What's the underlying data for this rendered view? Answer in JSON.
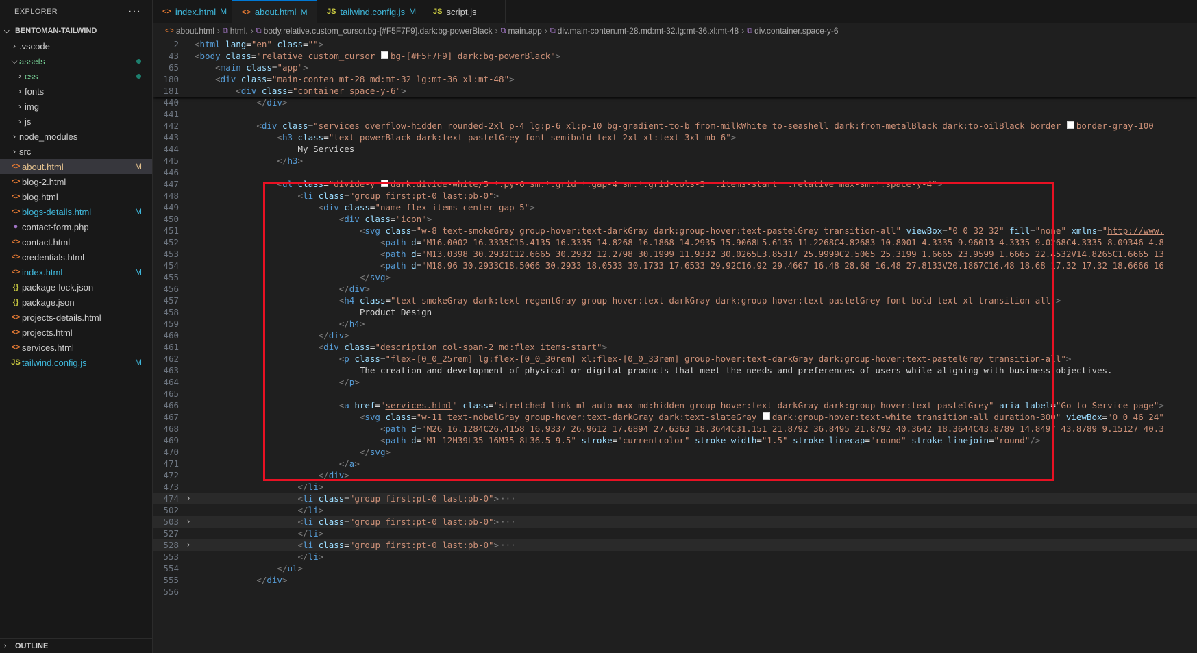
{
  "explorer": {
    "title": "EXPLORER",
    "more": "···",
    "project": "BENTOMAN-TAILWIND",
    "items": [
      {
        "label": ".vscode",
        "type": "folder",
        "indent": 1,
        "open": false,
        "color": "#cccccc"
      },
      {
        "label": "assets",
        "type": "folder",
        "indent": 1,
        "open": true,
        "color": "#73c991",
        "dot": true
      },
      {
        "label": "css",
        "type": "folder",
        "indent": 2,
        "open": false,
        "color": "#73c991",
        "dot": true
      },
      {
        "label": "fonts",
        "type": "folder",
        "indent": 2,
        "open": false,
        "color": "#cccccc"
      },
      {
        "label": "img",
        "type": "folder",
        "indent": 2,
        "open": false,
        "color": "#cccccc"
      },
      {
        "label": "js",
        "type": "folder",
        "indent": 2,
        "open": false,
        "color": "#cccccc"
      },
      {
        "label": "node_modules",
        "type": "folder",
        "indent": 1,
        "open": false,
        "color": "#cccccc"
      },
      {
        "label": "src",
        "type": "folder",
        "indent": 1,
        "open": false,
        "color": "#cccccc"
      },
      {
        "label": "about.html",
        "type": "html",
        "indent": 1,
        "color": "#e2c08d",
        "badge": "M",
        "active": true
      },
      {
        "label": "blog-2.html",
        "type": "html",
        "indent": 1,
        "color": "#cccccc"
      },
      {
        "label": "blog.html",
        "type": "html",
        "indent": 1,
        "color": "#cccccc"
      },
      {
        "label": "blogs-details.html",
        "type": "html",
        "indent": 1,
        "color": "#3fb6d9",
        "badge": "M"
      },
      {
        "label": "contact-form.php",
        "type": "php",
        "indent": 1,
        "color": "#cccccc"
      },
      {
        "label": "contact.html",
        "type": "html",
        "indent": 1,
        "color": "#cccccc"
      },
      {
        "label": "credentials.html",
        "type": "html",
        "indent": 1,
        "color": "#cccccc"
      },
      {
        "label": "index.html",
        "type": "html",
        "indent": 1,
        "color": "#3fb6d9",
        "badge": "M"
      },
      {
        "label": "package-lock.json",
        "type": "json",
        "indent": 1,
        "color": "#cccccc"
      },
      {
        "label": "package.json",
        "type": "json",
        "indent": 1,
        "color": "#cccccc"
      },
      {
        "label": "projects-details.html",
        "type": "html",
        "indent": 1,
        "color": "#cccccc"
      },
      {
        "label": "projects.html",
        "type": "html",
        "indent": 1,
        "color": "#cccccc"
      },
      {
        "label": "services.html",
        "type": "html",
        "indent": 1,
        "color": "#cccccc"
      },
      {
        "label": "tailwind.config.js",
        "type": "js",
        "indent": 1,
        "color": "#3fb6d9",
        "badge": "M"
      }
    ],
    "outline": "OUTLINE"
  },
  "tabs": [
    {
      "label": "index.html",
      "icon": "<>",
      "iconColor": "#e37933",
      "mod": "M",
      "color": "#3fb6d9",
      "active": false
    },
    {
      "label": "about.html",
      "icon": "<>",
      "iconColor": "#e37933",
      "mod": "M",
      "color": "#3fb6d9",
      "active": true
    },
    {
      "label": "tailwind.config.js",
      "icon": "JS",
      "iconColor": "#cbcb41",
      "mod": "M",
      "color": "#3fb6d9",
      "active": false
    },
    {
      "label": "script.js",
      "icon": "JS",
      "iconColor": "#cbcb41",
      "mod": "",
      "color": "#cccccc",
      "active": false
    }
  ],
  "breadcrumb": [
    {
      "label": "about.html",
      "icon": "<>"
    },
    {
      "label": "html.",
      "icon": "⧉"
    },
    {
      "label": "body.relative.custom_cursor.bg-[#F5F7F9].dark:bg-powerBlack",
      "icon": "⧉"
    },
    {
      "label": "main.app",
      "icon": "⧉"
    },
    {
      "label": "div.main-conten.mt-28.md:mt-32.lg:mt-36.xl:mt-48",
      "icon": "⧉"
    },
    {
      "label": "div.container.space-y-6",
      "icon": "⧉"
    }
  ],
  "code": {
    "sticky": [
      {
        "n": "2",
        "html": "<span class='p'>&lt;</span><span class='t'>html</span> <span class='a'>lang</span><span class='x'>=</span><span class='s'>\"en\"</span> <span class='a'>class</span><span class='x'>=</span><span class='s'>\"\"</span><span class='p'>&gt;</span>"
      },
      {
        "n": "43",
        "html": "<span class='p'>&lt;</span><span class='t'>body</span> <span class='a'>class</span><span class='x'>=</span><span class='s'>\"relative custom_cursor <span class='colorbox'></span>bg-[#F5F7F9] dark:bg-powerBlack\"</span><span class='p'>&gt;</span>"
      },
      {
        "n": "65",
        "html": "    <span class='p'>&lt;</span><span class='t'>main</span> <span class='a'>class</span><span class='x'>=</span><span class='s'>\"app\"</span><span class='p'>&gt;</span>"
      },
      {
        "n": "180",
        "html": "    <span class='p'>&lt;</span><span class='t'>div</span> <span class='a'>class</span><span class='x'>=</span><span class='s'>\"main-conten mt-28 md:mt-32 lg:mt-36 xl:mt-48\"</span><span class='p'>&gt;</span>"
      },
      {
        "n": "181",
        "html": "        <span class='p'>&lt;</span><span class='t'>div</span> <span class='a'>class</span><span class='x'>=</span><span class='s'>\"container space-y-6\"</span><span class='p'>&gt;</span>"
      }
    ],
    "lines": [
      {
        "n": "440",
        "html": "            <span class='p'>&lt;/</span><span class='t'>div</span><span class='p'>&gt;</span>"
      },
      {
        "n": "441",
        "html": ""
      },
      {
        "n": "442",
        "html": "            <span class='p'>&lt;</span><span class='t'>div</span> <span class='a'>class</span><span class='x'>=</span><span class='s'>\"services overflow-hidden rounded-2xl p-4 lg:p-6 xl:p-10 bg-gradient-to-b from-milkWhite to-seashell dark:from-metalBlack dark:to-oilBlack border <span class='colorbox'></span>border-gray-100</span>"
      },
      {
        "n": "443",
        "html": "                <span class='p'>&lt;</span><span class='t'>h3</span> <span class='a'>class</span><span class='x'>=</span><span class='s'>\"text-powerBlack dark:text-pastelGrey font-semibold text-2xl xl:text-3xl mb-6\"</span><span class='p'>&gt;</span>"
      },
      {
        "n": "444",
        "html": "                    <span class='x'>My Services</span>"
      },
      {
        "n": "445",
        "html": "                <span class='p'>&lt;/</span><span class='t'>h3</span><span class='p'>&gt;</span>"
      },
      {
        "n": "446",
        "html": ""
      },
      {
        "n": "447",
        "html": "                <span class='p'>&lt;</span><span class='t'>ul</span> <span class='a'>class</span><span class='x'>=</span><span class='s'>\"divide-y <span class='colorbox dk'></span>dark:divide-white/5 *:py-6 sm:*:grid *:gap-4 sm:*:grid-cols-3 *:items-start *:relative max-sm:*:space-y-4\"</span><span class='p'>&gt;</span>"
      },
      {
        "n": "448",
        "html": "                    <span class='p'>&lt;</span><span class='t'>li</span> <span class='a'>class</span><span class='x'>=</span><span class='s'>\"group first:pt-0 last:pb-0\"</span><span class='p'>&gt;</span>"
      },
      {
        "n": "449",
        "html": "                        <span class='p'>&lt;</span><span class='t'>div</span> <span class='a'>class</span><span class='x'>=</span><span class='s'>\"name flex items-center gap-5\"</span><span class='p'>&gt;</span>"
      },
      {
        "n": "450",
        "html": "                            <span class='p'>&lt;</span><span class='t'>div</span> <span class='a'>class</span><span class='x'>=</span><span class='s'>\"icon\"</span><span class='p'>&gt;</span>"
      },
      {
        "n": "451",
        "html": "                                <span class='p'>&lt;</span><span class='t'>svg</span> <span class='a'>class</span><span class='x'>=</span><span class='s'>\"w-8 text-smokeGray group-hover:text-darkGray dark:group-hover:text-pastelGrey transition-all\"</span> <span class='a'>viewBox</span><span class='x'>=</span><span class='s'>\"0 0 32 32\"</span> <span class='a'>fill</span><span class='x'>=</span><span class='s'>\"none\"</span> <span class='a'>xmlns</span><span class='x'>=</span><span class='s'>\"<span class='u'>http://www.</span></span>"
      },
      {
        "n": "452",
        "html": "                                    <span class='p'>&lt;</span><span class='t'>path</span> <span class='a'>d</span><span class='x'>=</span><span class='s'>\"M16.0002 16.3335C15.4135 16.3335 14.8268 16.1868 14.2935 15.9068L5.6135 11.2268C4.82683 10.8001 4.3335 9.96013 4.3335 9.0268C4.3335 8.09346 4.8</span>"
      },
      {
        "n": "453",
        "html": "                                    <span class='p'>&lt;</span><span class='t'>path</span> <span class='a'>d</span><span class='x'>=</span><span class='s'>\"M13.0398 30.2932C12.6665 30.2932 12.2798 30.1999 11.9332 30.0265L3.85317 25.9999C2.5065 25.3199 1.6665 23.9599 1.6665 22.4532V14.8265C1.6665 13</span>"
      },
      {
        "n": "454",
        "html": "                                    <span class='p'>&lt;</span><span class='t'>path</span> <span class='a'>d</span><span class='x'>=</span><span class='s'>\"M18.96 30.2933C18.5066 30.2933 18.0533 30.1733 17.6533 29.92C16.92 29.4667 16.48 28.68 16.48 27.8133V20.1867C16.48 18.68 17.32 17.32 18.6666 16</span>"
      },
      {
        "n": "455",
        "html": "                                <span class='p'>&lt;/</span><span class='t'>svg</span><span class='p'>&gt;</span>"
      },
      {
        "n": "456",
        "html": "                            <span class='p'>&lt;/</span><span class='t'>div</span><span class='p'>&gt;</span>"
      },
      {
        "n": "457",
        "html": "                            <span class='p'>&lt;</span><span class='t'>h4</span> <span class='a'>class</span><span class='x'>=</span><span class='s'>\"text-smokeGray dark:text-regentGray group-hover:text-darkGray dark:group-hover:text-pastelGrey font-bold text-xl transition-all\"</span><span class='p'>&gt;</span>"
      },
      {
        "n": "458",
        "html": "                                <span class='x'>Product Design</span>"
      },
      {
        "n": "459",
        "html": "                            <span class='p'>&lt;/</span><span class='t'>h4</span><span class='p'>&gt;</span>"
      },
      {
        "n": "460",
        "html": "                        <span class='p'>&lt;/</span><span class='t'>div</span><span class='p'>&gt;</span>"
      },
      {
        "n": "461",
        "html": "                        <span class='p'>&lt;</span><span class='t'>div</span> <span class='a'>class</span><span class='x'>=</span><span class='s'>\"description col-span-2 md:flex items-start\"</span><span class='p'>&gt;</span>"
      },
      {
        "n": "462",
        "html": "                            <span class='p'>&lt;</span><span class='t'>p</span> <span class='a'>class</span><span class='x'>=</span><span class='s'>\"flex-[0_0_25rem] lg:flex-[0_0_30rem] xl:flex-[0_0_33rem] group-hover:text-darkGray dark:group-hover:text-pastelGrey transition-all\"</span><span class='p'>&gt;</span>"
      },
      {
        "n": "463",
        "html": "                                <span class='x'>The creation and development of physical or digital products that meet the needs and preferences of users while aligning with business objectives.</span>"
      },
      {
        "n": "464",
        "html": "                            <span class='p'>&lt;/</span><span class='t'>p</span><span class='p'>&gt;</span>"
      },
      {
        "n": "465",
        "html": ""
      },
      {
        "n": "466",
        "html": "                            <span class='p'>&lt;</span><span class='t'>a</span> <span class='a'>href</span><span class='x'>=</span><span class='s'>\"<span class='u'>services.html</span>\"</span> <span class='a'>class</span><span class='x'>=</span><span class='s'>\"stretched-link ml-auto max-md:hidden group-hover:text-darkGray dark:group-hover:text-pastelGrey\"</span> <span class='a'>aria-label</span><span class='x'>=</span><span class='s'>\"Go to Service page\"</span><span class='p'>&gt;</span>"
      },
      {
        "n": "467",
        "html": "                                <span class='p'>&lt;</span><span class='t'>svg</span> <span class='a'>class</span><span class='x'>=</span><span class='s'>\"w-11 text-nobelGray group-hover:text-darkGray dark:text-slateGray <span class='colorbox'></span>dark:group-hover:text-white transition-all duration-300\"</span> <span class='a'>viewBox</span><span class='x'>=</span><span class='s'>\"0 0 46 24\"</span>"
      },
      {
        "n": "468",
        "html": "                                    <span class='p'>&lt;</span><span class='t'>path</span> <span class='a'>d</span><span class='x'>=</span><span class='s'>\"M26 16.1284C26.4158 16.9337 26.9612 17.6894 27.6363 18.3644C31.151 21.8792 36.8495 21.8792 40.3642 18.3644C43.8789 14.8497 43.8789 9.15127 40.3</span>"
      },
      {
        "n": "469",
        "html": "                                    <span class='p'>&lt;</span><span class='t'>path</span> <span class='a'>d</span><span class='x'>=</span><span class='s'>\"M1 12H39L35 16M35 8L36.5 9.5\"</span> <span class='a'>stroke</span><span class='x'>=</span><span class='s'>\"currentcolor\"</span> <span class='a'>stroke-width</span><span class='x'>=</span><span class='s'>\"1.5\"</span> <span class='a'>stroke-linecap</span><span class='x'>=</span><span class='s'>\"round\"</span> <span class='a'>stroke-linejoin</span><span class='x'>=</span><span class='s'>\"round\"</span><span class='p'>/&gt;</span>"
      },
      {
        "n": "470",
        "html": "                                <span class='p'>&lt;/</span><span class='t'>svg</span><span class='p'>&gt;</span>"
      },
      {
        "n": "471",
        "html": "                            <span class='p'>&lt;/</span><span class='t'>a</span><span class='p'>&gt;</span>"
      },
      {
        "n": "472",
        "html": "                        <span class='p'>&lt;/</span><span class='t'>div</span><span class='p'>&gt;</span>"
      },
      {
        "n": "473",
        "html": "                    <span class='p'>&lt;/</span><span class='t'>li</span><span class='p'>&gt;</span>"
      },
      {
        "n": "474",
        "fold": true,
        "html": "                    <span class='p'>&lt;</span><span class='t'>li</span> <span class='a'>class</span><span class='x'>=</span><span class='s'>\"group first:pt-0 last:pb-0\"</span><span class='p'>&gt;</span><span class='fold-dots'>···</span>"
      },
      {
        "n": "502",
        "html": "                    <span class='p'>&lt;/</span><span class='t'>li</span><span class='p'>&gt;</span>"
      },
      {
        "n": "503",
        "fold": true,
        "html": "                    <span class='p'>&lt;</span><span class='t'>li</span> <span class='a'>class</span><span class='x'>=</span><span class='s'>\"group first:pt-0 last:pb-0\"</span><span class='p'>&gt;</span><span class='fold-dots'>···</span>"
      },
      {
        "n": "527",
        "html": "                    <span class='p'>&lt;/</span><span class='t'>li</span><span class='p'>&gt;</span>"
      },
      {
        "n": "528",
        "fold": true,
        "html": "                    <span class='p'>&lt;</span><span class='t'>li</span> <span class='a'>class</span><span class='x'>=</span><span class='s'>\"group first:pt-0 last:pb-0\"</span><span class='p'>&gt;</span><span class='fold-dots'>···</span>"
      },
      {
        "n": "553",
        "html": "                    <span class='p'>&lt;/</span><span class='t'>li</span><span class='p'>&gt;</span>"
      },
      {
        "n": "554",
        "html": "                <span class='p'>&lt;/</span><span class='t'>ul</span><span class='p'>&gt;</span>"
      },
      {
        "n": "555",
        "html": "            <span class='p'>&lt;/</span><span class='t'>div</span><span class='p'>&gt;</span>"
      },
      {
        "n": "556",
        "html": ""
      }
    ]
  },
  "highlight": {
    "color": "#e81123"
  }
}
